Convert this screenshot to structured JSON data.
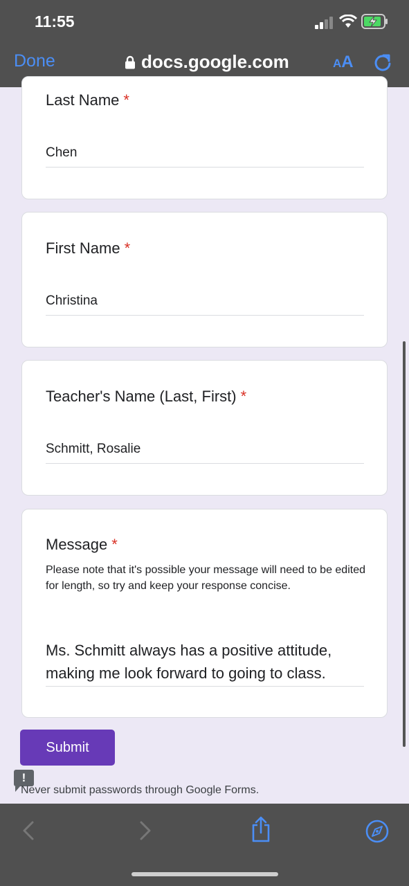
{
  "status_bar": {
    "time": "11:55"
  },
  "browser": {
    "done_label": "Done",
    "url": "docs.google.com",
    "text_size_small": "A",
    "text_size_large": "A"
  },
  "form": {
    "fields": [
      {
        "label": "Last Name",
        "required_mark": "*",
        "value": "Chen"
      },
      {
        "label": "First Name",
        "required_mark": "*",
        "value": "Christina"
      },
      {
        "label": "Teacher's Name (Last, First)",
        "required_mark": "*",
        "value": "Schmitt, Rosalie"
      },
      {
        "label": "Message",
        "required_mark": "*",
        "description": "Please note that it's possible your message will need to be edited for length, so try and keep your response concise.",
        "value": "Ms. Schmitt always has a positive attitude, making me look forward to going to class."
      }
    ],
    "submit_label": "Submit",
    "warning_icon_glyph": "!",
    "warning_text": "Never submit passwords through Google Forms."
  },
  "colors": {
    "accent": "#673ab7",
    "safari_blue": "#4b8ef5",
    "required": "#d93025",
    "battery_green": "#4cd964"
  }
}
